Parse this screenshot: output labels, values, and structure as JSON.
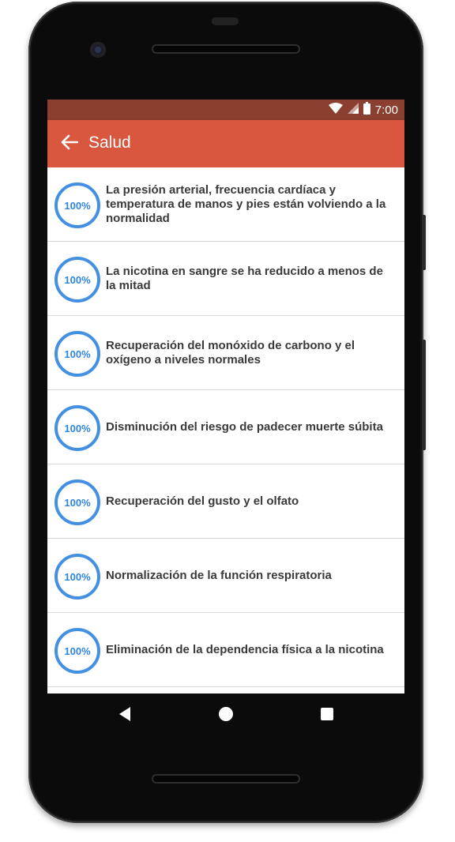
{
  "status_bar": {
    "time": "7:00",
    "icons": [
      "wifi-icon",
      "cell-signal-icon",
      "battery-icon"
    ]
  },
  "app_bar": {
    "title": "Salud",
    "back_icon": "arrow-back-icon",
    "color": "#d9573f"
  },
  "items": [
    {
      "progress_label": "100%",
      "progress": 1.0,
      "text": "La presión arterial, frecuencia cardíaca y temperatura de manos y pies están volviendo a la normalidad"
    },
    {
      "progress_label": "100%",
      "progress": 1.0,
      "text": "La nicotina en sangre se ha reducido a menos de la mitad"
    },
    {
      "progress_label": "100%",
      "progress": 1.0,
      "text": "Recuperación del monóxido de carbono y el oxígeno a niveles normales"
    },
    {
      "progress_label": "100%",
      "progress": 1.0,
      "text": "Disminución del riesgo de padecer muerte súbita"
    },
    {
      "progress_label": "100%",
      "progress": 1.0,
      "text": "Recuperación del gusto y el olfato"
    },
    {
      "progress_label": "100%",
      "progress": 1.0,
      "text": "Normalización de la función respiratoria"
    },
    {
      "progress_label": "100%",
      "progress": 1.0,
      "text": "Eliminación de la dependencia física a la nicotina"
    }
  ],
  "nav_bar": {
    "icons": [
      "back-triangle-icon",
      "home-circle-icon",
      "recents-square-icon"
    ]
  },
  "colors": {
    "accent": "#d9573f",
    "status_bar": "#8a3f30",
    "progress_ring": "#4390e3",
    "text": "#3a3a3a"
  }
}
